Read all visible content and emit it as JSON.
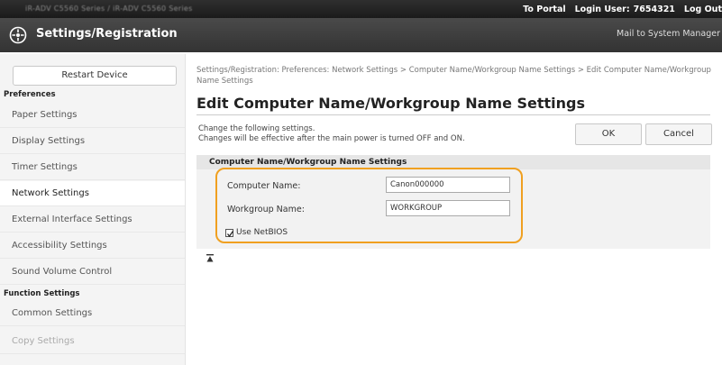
{
  "topbar": {
    "device_name": "iR-ADV C5560 Series / iR-ADV C5560 Series",
    "portal_link": "To Portal",
    "login_label": "Login User:",
    "login_user": "7654321",
    "logout_label": "Log Out"
  },
  "header": {
    "title": "Settings/Registration",
    "mail_link": "Mail to System Manager"
  },
  "sidebar": {
    "restart_button": "Restart Device",
    "preferences_heading": "Preferences",
    "preferences_items": [
      {
        "label": "Paper Settings"
      },
      {
        "label": "Display Settings"
      },
      {
        "label": "Timer Settings"
      },
      {
        "label": "Network Settings"
      },
      {
        "label": "External Interface Settings"
      },
      {
        "label": "Accessibility Settings"
      },
      {
        "label": "Sound Volume Control"
      }
    ],
    "function_heading": "Function Settings",
    "function_items": [
      {
        "label": "Common Settings"
      },
      {
        "label": "Copy Settings"
      }
    ]
  },
  "main": {
    "breadcrumb": "Settings/Registration: Preferences: Network Settings > Computer Name/Workgroup Name Settings > Edit Computer Name/Workgroup Name Settings",
    "page_title": "Edit Computer Name/Workgroup Name Settings",
    "desc_line1": "Change the following settings.",
    "desc_line2": "Changes will be effective after the main power is turned OFF and ON.",
    "ok_button": "OK",
    "cancel_button": "Cancel",
    "section_title": "Computer Name/Workgroup Name Settings",
    "computer_name_label": "Computer Name:",
    "computer_name_value": "Canon000000",
    "workgroup_name_label": "Workgroup Name:",
    "workgroup_name_value": "WORKGROUP",
    "use_netbios_label": "Use NetBIOS",
    "use_netbios_checked": true
  },
  "colors": {
    "highlight": "#f0a020",
    "topbar": "#1f1f1f",
    "sidebar_bg": "#f4f4f4"
  }
}
